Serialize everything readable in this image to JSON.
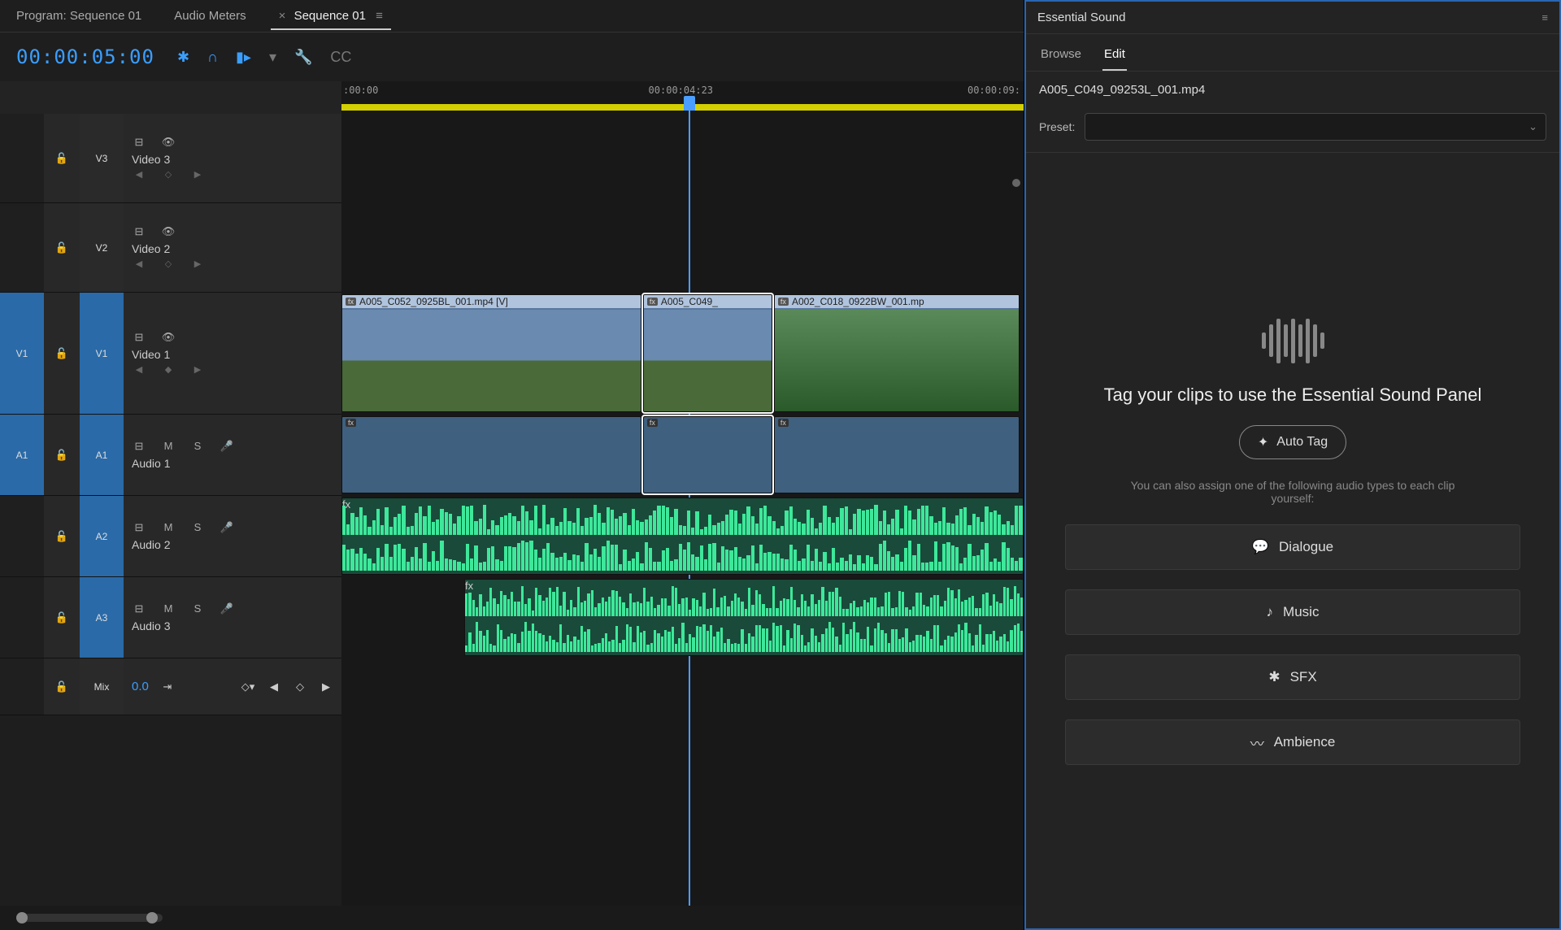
{
  "tabs": {
    "program": "Program: Sequence 01",
    "meters": "Audio Meters",
    "sequence": "Sequence 01"
  },
  "timecode": "00:00:05:00",
  "ruler": {
    "t0": ":00:00",
    "t1": "00:00:04:23",
    "t2": "00:00:09:"
  },
  "tracks": {
    "v3": {
      "code": "V3",
      "name": "Video 3"
    },
    "v2": {
      "code": "V2",
      "name": "Video 2"
    },
    "v1": {
      "srcCode": "V1",
      "tgtCode": "V1",
      "name": "Video 1"
    },
    "a1": {
      "srcCode": "A1",
      "tgtCode": "A1",
      "name": "Audio 1",
      "mute": "M",
      "solo": "S"
    },
    "a2": {
      "tgtCode": "A2",
      "name": "Audio 2",
      "mute": "M",
      "solo": "S"
    },
    "a3": {
      "tgtCode": "A3",
      "name": "Audio 3",
      "mute": "M",
      "solo": "S"
    },
    "mix": {
      "name": "Mix",
      "value": "0.0"
    }
  },
  "clips": {
    "c1": "A005_C052_0925BL_001.mp4 [V]",
    "c2": "A005_C049_",
    "c3": "A002_C018_0922BW_001.mp"
  },
  "fx": "fx",
  "es": {
    "title": "Essential Sound",
    "browse": "Browse",
    "edit": "Edit",
    "clipName": "A005_C049_09253L_001.mp4",
    "presetLabel": "Preset:",
    "headline": "Tag your clips to use the Essential Sound Panel",
    "autoTag": "Auto Tag",
    "hint": "You can also assign one of the following audio types to each clip yourself:",
    "dialogue": "Dialogue",
    "music": "Music",
    "sfx": "SFX",
    "ambience": "Ambience"
  }
}
